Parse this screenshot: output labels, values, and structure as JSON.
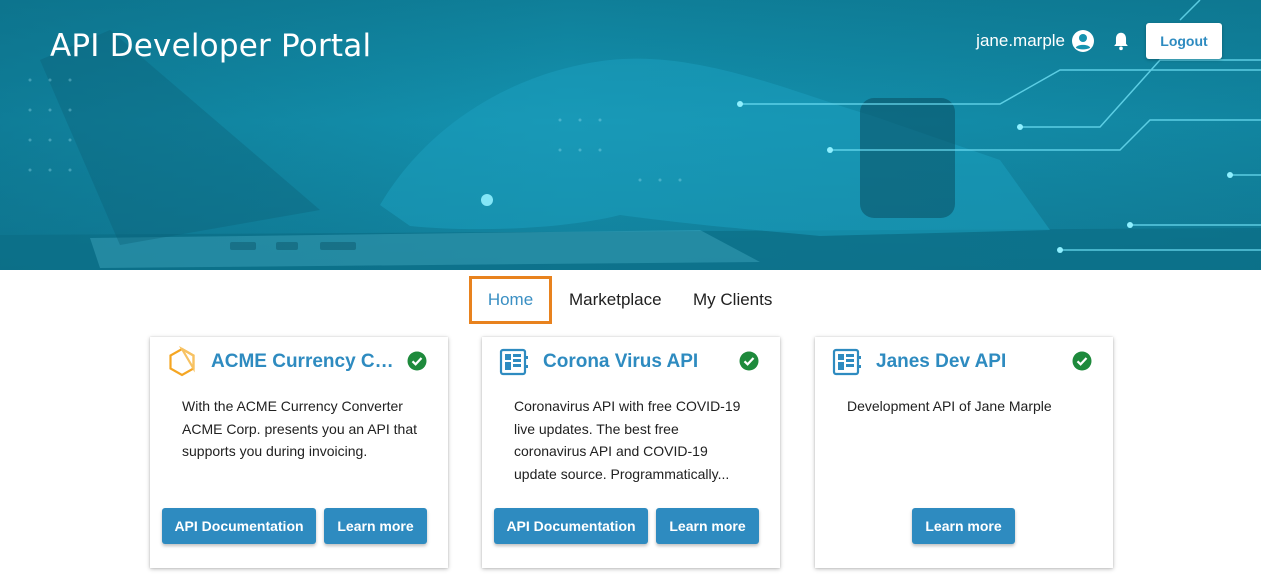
{
  "header": {
    "title": "API Developer Portal",
    "username": "jane.marple",
    "logout_label": "Logout",
    "icons": [
      "account-circle-icon",
      "bell-icon"
    ]
  },
  "nav": {
    "tabs": [
      {
        "label": "Home",
        "active": true
      },
      {
        "label": "Marketplace",
        "active": false
      },
      {
        "label": "My Clients",
        "active": false
      }
    ]
  },
  "cards": [
    {
      "title": "ACME Currency Co...",
      "icon": "hexagon-logo-icon",
      "status_icon": "check-circle-icon",
      "description": "With the ACME Currency Converter ACME Corp. presents you an API that supports you during invoicing.",
      "buttons": {
        "docs": "API Documentation",
        "learn": "Learn more"
      }
    },
    {
      "title": "Corona Virus API",
      "icon": "api-grid-icon",
      "status_icon": "check-circle-icon",
      "description": "Coronavirus API with free COVID-19 live updates. The best free coronavirus API and COVID-19 update source. Programmatically...",
      "buttons": {
        "docs": "API Documentation",
        "learn": "Learn more"
      }
    },
    {
      "title": "Janes Dev API",
      "icon": "api-grid-icon",
      "status_icon": "check-circle-icon",
      "description": "Development API of Jane Marple",
      "buttons": {
        "learn": "Learn more"
      }
    }
  ],
  "colors": {
    "accent": "#2e8bc0",
    "hero": "#1493b0",
    "active_tab_outline": "#e8821e",
    "status_ok": "#1e8a3c"
  }
}
